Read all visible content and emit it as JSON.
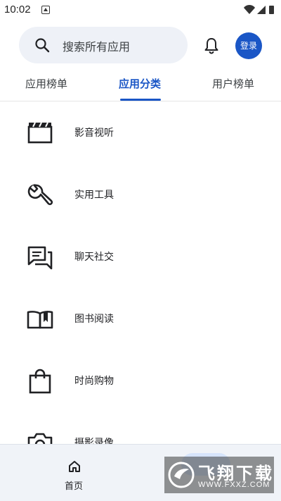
{
  "status_bar": {
    "time": "10:02"
  },
  "header": {
    "search_placeholder": "搜索所有应用",
    "login_label": "登录"
  },
  "tabs": [
    {
      "label": "应用榜单",
      "active": false
    },
    {
      "label": "应用分类",
      "active": true
    },
    {
      "label": "用户榜单",
      "active": false
    }
  ],
  "categories": [
    {
      "label": "影音视听",
      "icon": "clapperboard-icon"
    },
    {
      "label": "实用工具",
      "icon": "wrench-icon"
    },
    {
      "label": "聊天社交",
      "icon": "chat-icon"
    },
    {
      "label": "图书阅读",
      "icon": "book-icon"
    },
    {
      "label": "时尚购物",
      "icon": "shopping-bag-icon"
    },
    {
      "label": "摄影录像",
      "icon": "camera-icon"
    }
  ],
  "bottom_nav": [
    {
      "label": "首页",
      "icon": "home-icon"
    }
  ],
  "watermark": {
    "title": "飞翔下载",
    "url": "WWW.FXXZ.COM"
  },
  "colors": {
    "accent": "#1a56c6",
    "search_bg": "#eef1f7",
    "nav_bg": "#f0f3f8"
  }
}
